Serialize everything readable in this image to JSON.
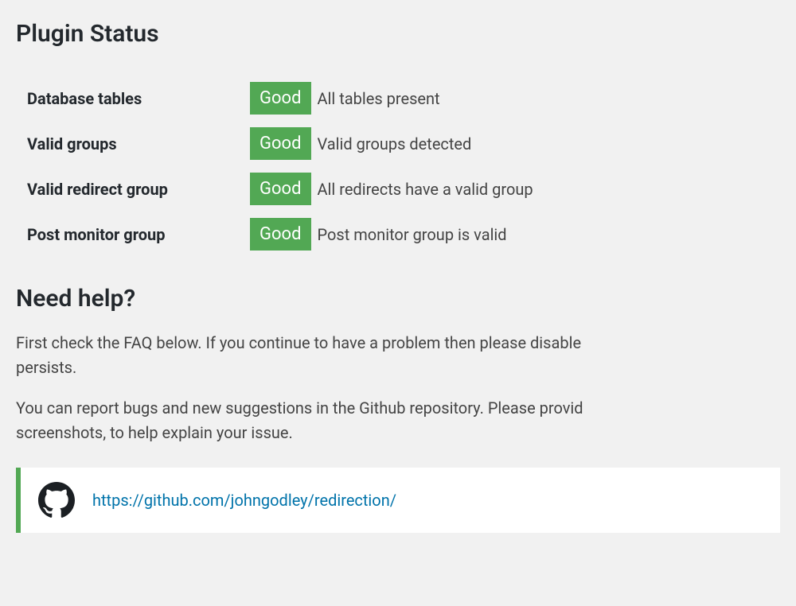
{
  "headings": {
    "plugin_status": "Plugin Status",
    "need_help": "Need help?"
  },
  "status": [
    {
      "label": "Database tables",
      "badge": "Good",
      "desc": "All tables present"
    },
    {
      "label": "Valid groups",
      "badge": "Good",
      "desc": "Valid groups detected"
    },
    {
      "label": "Valid redirect group",
      "badge": "Good",
      "desc": "All redirects have a valid group"
    },
    {
      "label": "Post monitor group",
      "badge": "Good",
      "desc": "Post monitor group is valid"
    }
  ],
  "help": {
    "p1a": "First check the FAQ below. If you continue to have a problem then please disable",
    "p1b": "persists.",
    "p2a": "You can report bugs and new suggestions in the Github repository. Please provid",
    "p2b": "screenshots, to help explain your issue.",
    "github_url": "https://github.com/johngodley/redirection/"
  },
  "colors": {
    "badge_bg": "#52a854",
    "link": "#0073aa"
  }
}
